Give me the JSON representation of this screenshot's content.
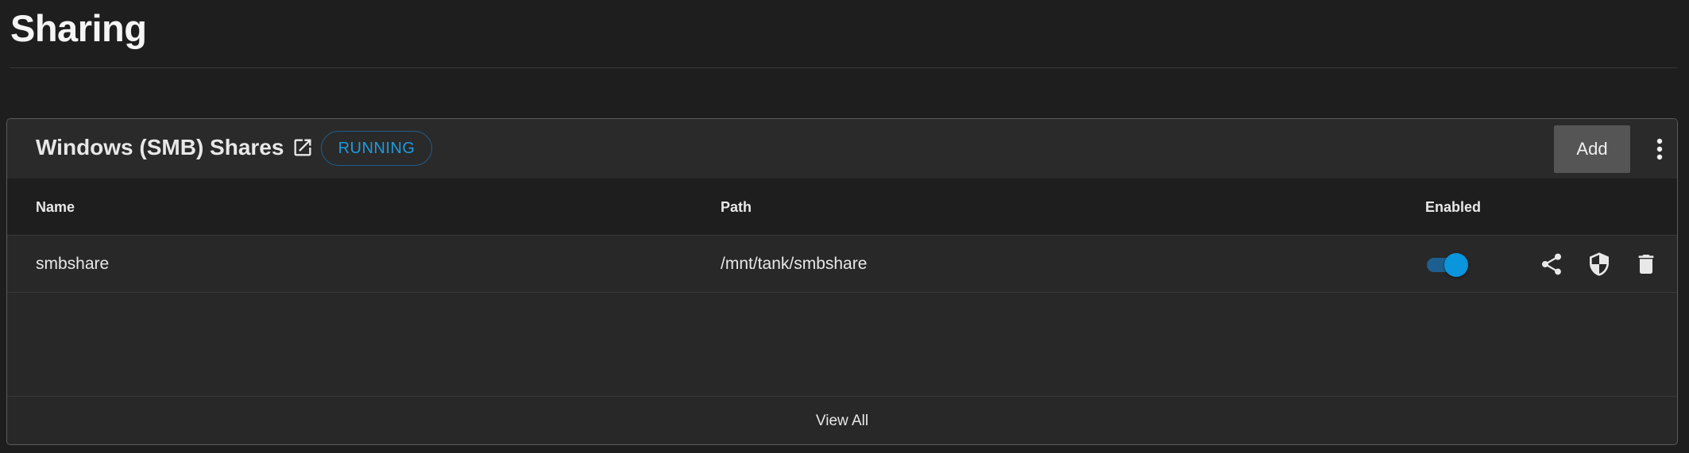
{
  "page": {
    "title": "Sharing"
  },
  "card": {
    "title": "Windows (SMB) Shares",
    "external_link_icon": "open-in-new-icon",
    "status": "RUNNING",
    "status_color": "#1e9ae0",
    "add_label": "Add",
    "more_icon": "more-vertical-icon"
  },
  "table": {
    "columns": [
      "Name",
      "Path",
      "Enabled"
    ],
    "rows": [
      {
        "name": "smbshare",
        "path": "/mnt/tank/smbshare",
        "enabled": true,
        "actions": [
          "share-icon",
          "shield-icon",
          "delete-icon"
        ]
      }
    ]
  },
  "footer": {
    "view_all_label": "View All"
  },
  "colors": {
    "background": "#1e1e1e",
    "card": "#282828",
    "accent": "#0a95dc"
  }
}
